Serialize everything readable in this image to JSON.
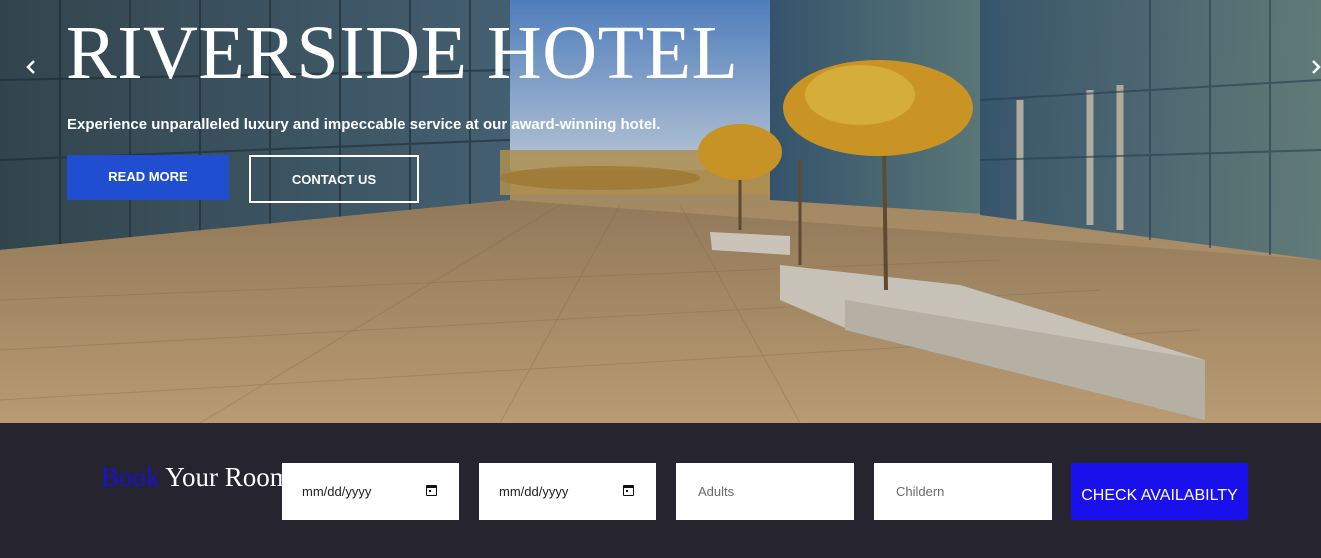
{
  "hero": {
    "title": "RIVERSIDE HOTEL",
    "subtitle": "Experience unparalleled luxury and impeccable service at our award-winning hotel.",
    "read_more_label": "READ MORE",
    "contact_label": "CONTACT US",
    "prev_icon": "chevron-left-icon",
    "next_icon": "chevron-right-icon"
  },
  "booking": {
    "heading_accent": "Book",
    "heading_rest": "Your Rooms",
    "check_in_value": "mm/dd/yyyy",
    "check_out_value": "mm/dd/yyyy",
    "adults_placeholder": "Adults",
    "children_placeholder": "Childern",
    "check_button_label": "CHECK AVAILABILTY"
  },
  "colors": {
    "primary_button": "#1f4fd0",
    "check_button": "#1a10ec",
    "booking_bg": "#26252f",
    "heading_accent": "#1a0fd9"
  }
}
